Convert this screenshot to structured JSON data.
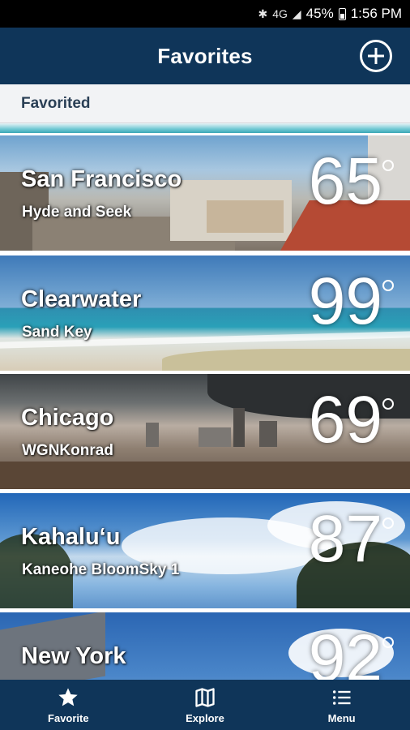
{
  "status_bar": {
    "network": "4G",
    "battery": "45%",
    "time": "1:56 PM",
    "icons": [
      "bluetooth-icon",
      "network-icon",
      "signal-icon",
      "battery-icon"
    ]
  },
  "app_bar": {
    "title": "Favorites",
    "action_icon": "add-circle-icon"
  },
  "section": {
    "title": "Favorited"
  },
  "favorites": [
    {
      "city": "San Francisco",
      "station": "Hyde and Seek",
      "temp": "65"
    },
    {
      "city": "Clearwater",
      "station": "Sand Key",
      "temp": "99"
    },
    {
      "city": "Chicago",
      "station": "WGNKonrad",
      "temp": "69"
    },
    {
      "city": "Kahalu‘u",
      "station": "Kaneohe BloomSky 1",
      "temp": "87"
    },
    {
      "city": "New York",
      "station": "",
      "temp": "92"
    }
  ],
  "bottom_nav": {
    "items": [
      {
        "label": "Favorite",
        "icon": "star-icon"
      },
      {
        "label": "Explore",
        "icon": "map-icon"
      },
      {
        "label": "Menu",
        "icon": "menu-list-icon"
      }
    ]
  },
  "colors": {
    "primary": "#0f3559",
    "accent": "#3aa7b6",
    "section_bg": "#f2f3f5"
  }
}
